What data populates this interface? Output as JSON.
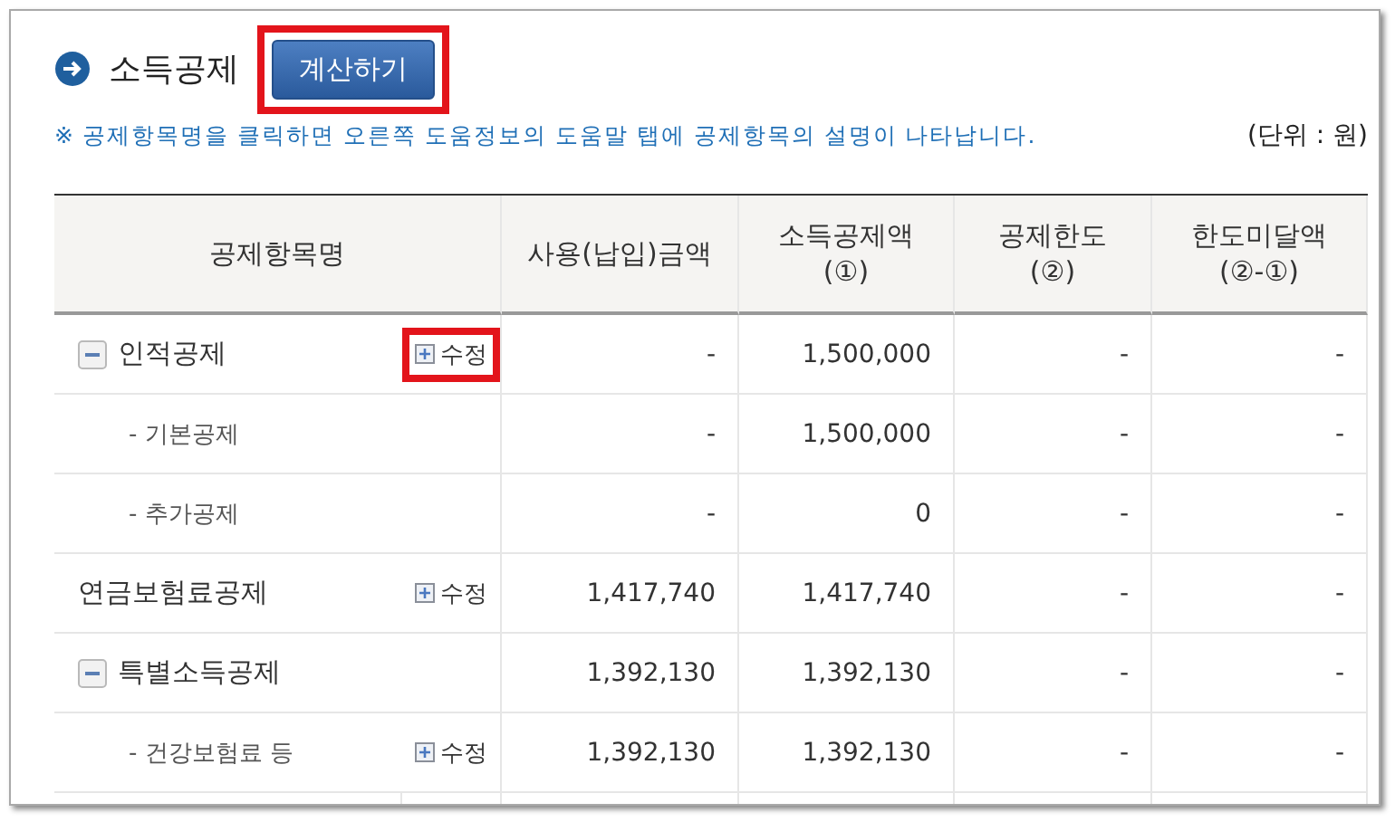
{
  "section": {
    "title": "소득공제",
    "button": {
      "label": "계산하기",
      "highlighted": true
    }
  },
  "notice": "※ 공제항목명을 클릭하면 오른쪽 도움정보의 도움말 탭에 공제항목의 설명이 나타납니다.",
  "unit": "(단위 : 원)",
  "table": {
    "columns": [
      "공제항목명",
      "사용(납입)금액",
      "소득공제액\n(①)",
      "공제한도\n(②)",
      "한도미달액\n(②-①)"
    ],
    "rows": [
      {
        "kind": "group",
        "expanded": true,
        "name": "인적공제",
        "edit": {
          "label": "수정",
          "highlighted": true
        },
        "amount": "-",
        "deduction": "1,500,000",
        "limit": "-",
        "remaining": "-"
      },
      {
        "kind": "child",
        "name": "- 기본공제",
        "amount": "-",
        "deduction": "1,500,000",
        "limit": "-",
        "remaining": "-"
      },
      {
        "kind": "child",
        "name": "- 추가공제",
        "amount": "-",
        "deduction": "0",
        "limit": "-",
        "remaining": "-"
      },
      {
        "kind": "plain",
        "name": "연금보험료공제",
        "edit": {
          "label": "수정",
          "highlighted": false
        },
        "amount": "1,417,740",
        "deduction": "1,417,740",
        "limit": "-",
        "remaining": "-"
      },
      {
        "kind": "group",
        "expanded": true,
        "name": "특별소득공제",
        "amount": "1,392,130",
        "deduction": "1,392,130",
        "limit": "-",
        "remaining": "-"
      },
      {
        "kind": "child",
        "name": "- 건강보험료 등",
        "edit": {
          "label": "수정",
          "highlighted": false
        },
        "amount": "1,392,130",
        "deduction": "1,392,130",
        "limit": "-",
        "remaining": "-"
      }
    ]
  }
}
